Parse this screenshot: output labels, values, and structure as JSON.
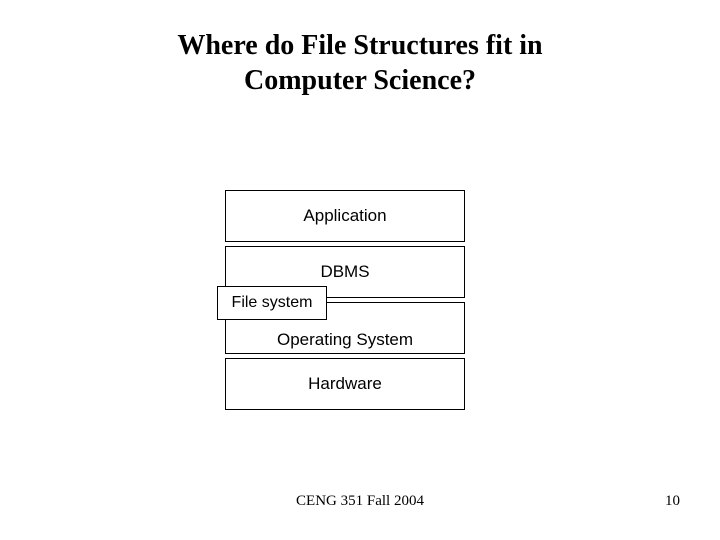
{
  "title_line1": "Where do File Structures fit in",
  "title_line2": "Computer Science?",
  "layers": {
    "application": "Application",
    "dbms": "DBMS",
    "file_system": "File system",
    "operating_system": "Operating System",
    "hardware": "Hardware"
  },
  "footer": {
    "course": "CENG 351 Fall 2004",
    "page": "10"
  }
}
